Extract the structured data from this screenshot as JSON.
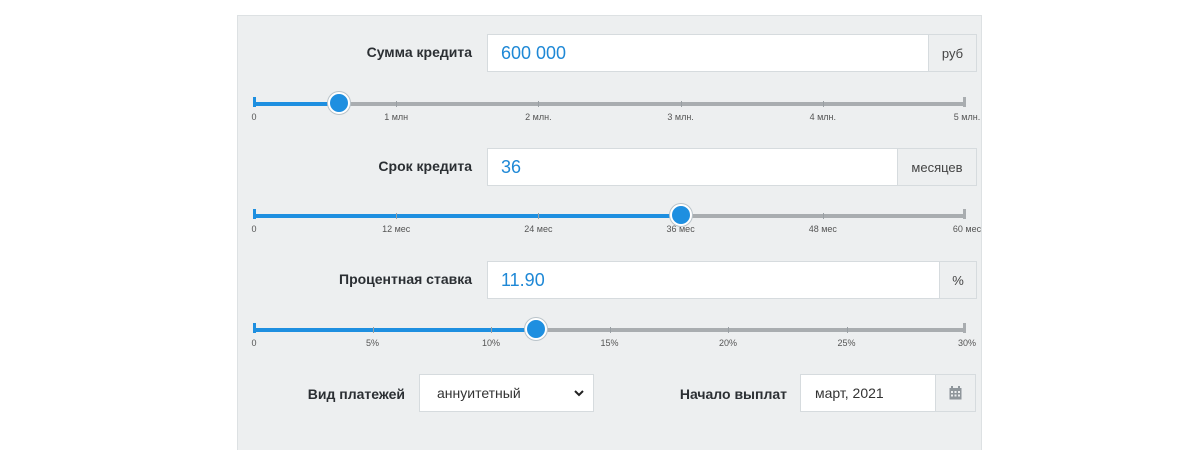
{
  "loan_amount": {
    "label": "Сумма кредита",
    "value": "600 000",
    "unit": "руб",
    "slider": {
      "min": 0,
      "max": 5000000,
      "value": 600000,
      "ticks": [
        "0",
        "1 млн",
        "2 млн.",
        "3 млн.",
        "4 млн.",
        "5 млн."
      ]
    }
  },
  "loan_term": {
    "label": "Срок кредита",
    "value": "36",
    "unit": "месяцев",
    "slider": {
      "min": 0,
      "max": 60,
      "value": 36,
      "ticks": [
        "0",
        "12 мес",
        "24 мес",
        "36 мес",
        "48 мес",
        "60 мес"
      ]
    }
  },
  "interest_rate": {
    "label": "Процентная ставка",
    "value": "11.90",
    "unit": "%",
    "slider": {
      "min": 0,
      "max": 30,
      "value": 11.9,
      "ticks": [
        "0",
        "5%",
        "10%",
        "15%",
        "20%",
        "25%",
        "30%"
      ]
    }
  },
  "payment_type": {
    "label": "Вид платежей",
    "selected": "аннуитетный"
  },
  "payment_start": {
    "label": "Начало выплат",
    "value": "март, 2021"
  },
  "colors": {
    "accent": "#1e8fe0",
    "panel_bg": "#edeff0",
    "track": "#a9adb0"
  }
}
